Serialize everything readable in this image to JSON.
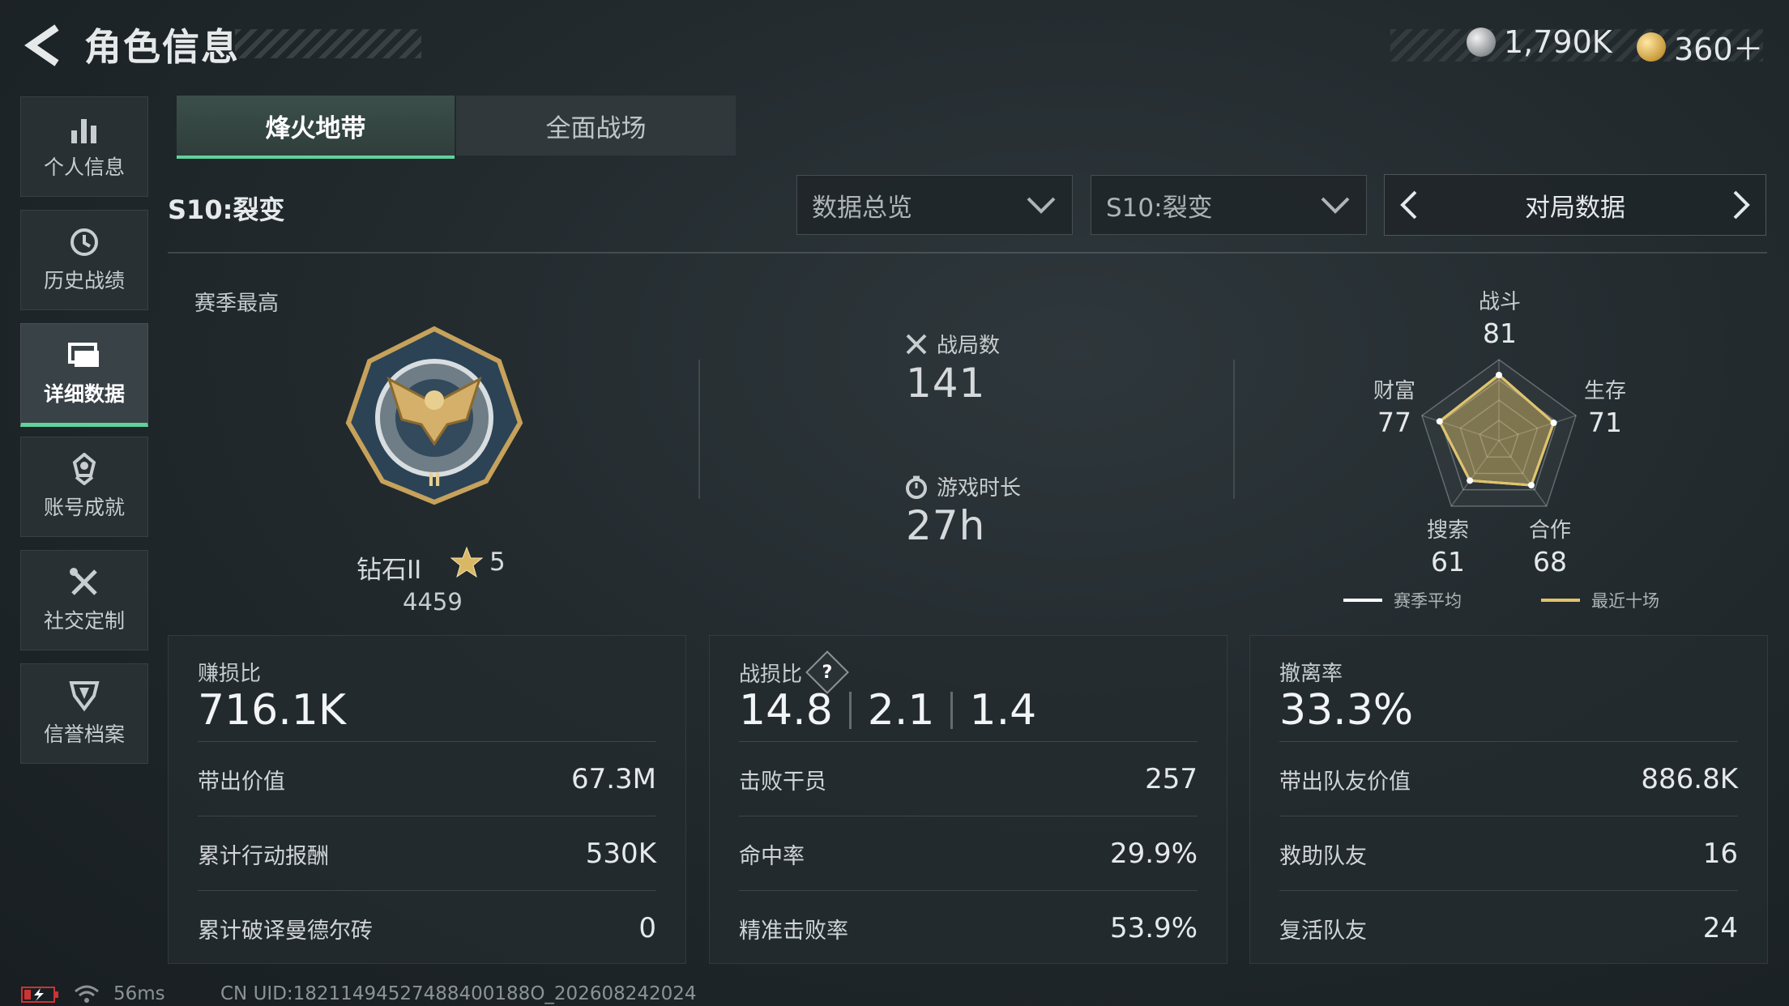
{
  "header": {
    "title": "角色信息",
    "currency_silver": "1,790K",
    "currency_gold": "360＋"
  },
  "sidebar": {
    "items": [
      {
        "label": "个人信息",
        "icon": "bar-chart-icon",
        "active": false
      },
      {
        "label": "历史战绩",
        "icon": "history-clock-icon",
        "active": false
      },
      {
        "label": "详细数据",
        "icon": "cards-icon",
        "active": true
      },
      {
        "label": "账号成就",
        "icon": "achievement-badge-icon",
        "active": false
      },
      {
        "label": "社交定制",
        "icon": "tools-icon",
        "active": false
      },
      {
        "label": "信誉档案",
        "icon": "shield-icon",
        "active": false
      }
    ]
  },
  "tabs": [
    {
      "label": "烽火地带",
      "active": true
    },
    {
      "label": "全面战场",
      "active": false
    }
  ],
  "season_title": "S10:裂变",
  "filters": {
    "overview": "数据总览",
    "season": "S10:裂变",
    "pager": "对局数据"
  },
  "rank": {
    "label": "赛季最高",
    "name": "钻石II",
    "stars": "5",
    "score": "4459"
  },
  "stats": {
    "matches_label": "战局数",
    "matches_value": "141",
    "playtime_label": "游戏时长",
    "playtime_value": "27h"
  },
  "radar": {
    "axes": [
      {
        "label": "战斗",
        "value": "81",
        "season_avg": 81,
        "recent10": 81
      },
      {
        "label": "生存",
        "value": "71",
        "season_avg": 71,
        "recent10": 71
      },
      {
        "label": "合作",
        "value": "68",
        "season_avg": 68,
        "recent10": 68
      },
      {
        "label": "搜索",
        "value": "61",
        "season_avg": 61,
        "recent10": 61
      },
      {
        "label": "财富",
        "value": "77",
        "season_avg": 77,
        "recent10": 77
      }
    ],
    "legend_season": "赛季平均",
    "legend_recent": "最近十场",
    "colors": {
      "season": "#ffffff",
      "recent": "#e0c36a"
    }
  },
  "panels": {
    "profit": {
      "title": "赚损比",
      "big": "716.1K",
      "rows": [
        {
          "label": "带出价值",
          "value": "67.3M"
        },
        {
          "label": "累计行动报酬",
          "value": "530K"
        },
        {
          "label": "累计破译曼德尔砖",
          "value": "0"
        }
      ]
    },
    "kd": {
      "title": "战损比",
      "big": [
        "14.8",
        "2.1",
        "1.4"
      ],
      "rows": [
        {
          "label": "击败干员",
          "value": "257"
        },
        {
          "label": "命中率",
          "value": "29.9%"
        },
        {
          "label": "精准击败率",
          "value": "53.9%"
        }
      ]
    },
    "extract": {
      "title": "撤离率",
      "big": "33.3%",
      "rows": [
        {
          "label": "带出队友价值",
          "value": "886.8K"
        },
        {
          "label": "救助队友",
          "value": "16"
        },
        {
          "label": "复活队友",
          "value": "24"
        }
      ]
    }
  },
  "footer": {
    "ping": "56ms",
    "uid": "CN UID:18211494527488400188O_202608242024"
  }
}
